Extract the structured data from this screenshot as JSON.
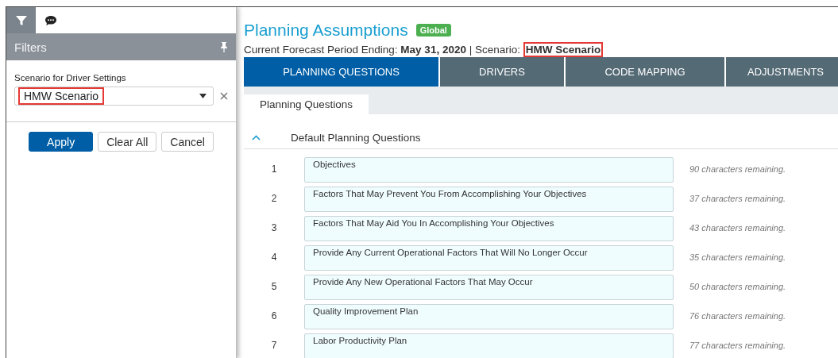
{
  "rail_tabs": [
    {
      "kind": "filter",
      "selected": true
    },
    {
      "kind": "chat",
      "selected": false
    }
  ],
  "filters": {
    "title": "Filters",
    "field_label": "Scenario for Driver Settings",
    "value": "HMW Scenario",
    "value_highlighted": true,
    "buttons": [
      {
        "label": "Apply",
        "kind": "primary"
      },
      {
        "label": "Clear All",
        "kind": "secondary"
      },
      {
        "label": "Cancel",
        "kind": "secondary"
      }
    ]
  },
  "header": {
    "title": "Planning Assumptions",
    "badge": "Global",
    "period_label": "Current Forecast Period Ending: ",
    "period": "May 31, 2020",
    "scenario_label": " | Scenario: ",
    "scenario": "HMW Scenario",
    "scenario_highlighted": true
  },
  "tabs": [
    {
      "label": "PLANNING QUESTIONS",
      "selected": true
    },
    {
      "label": "DRIVERS",
      "selected": false
    },
    {
      "label": "CODE MAPPING",
      "selected": false
    },
    {
      "label": "ADJUSTMENTS",
      "selected": false
    }
  ],
  "subtabs": [
    {
      "label": "Planning Questions",
      "selected": true
    }
  ],
  "section": {
    "title": "Default Planning Questions",
    "expanded": true,
    "rows": [
      {
        "number": "1",
        "value": "Objectives",
        "remaining": "90 characters remaining."
      },
      {
        "number": "2",
        "value": "Factors That May Prevent You From Accomplishing Your Objectives",
        "remaining": "37 characters remaining."
      },
      {
        "number": "3",
        "value": "Factors That May Aid You In Accomplishing Your Objectives",
        "remaining": "43 characters remaining."
      },
      {
        "number": "4",
        "value": "Provide Any Current Operational Factors That Will No Longer Occur",
        "remaining": "35 characters remaining."
      },
      {
        "number": "5",
        "value": "Provide Any New Operational Factors That May Occur",
        "remaining": "50 characters remaining."
      },
      {
        "number": "6",
        "value": "Quality Improvement Plan",
        "remaining": "76 characters remaining."
      },
      {
        "number": "7",
        "value": "Labor Productivity Plan",
        "remaining": "77 characters remaining."
      }
    ]
  }
}
